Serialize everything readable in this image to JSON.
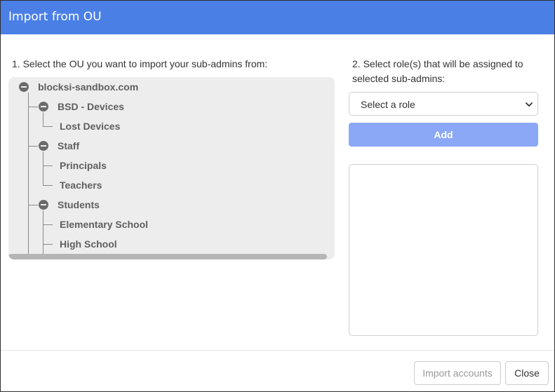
{
  "dialog": {
    "title": "Import from OU"
  },
  "step1": {
    "label": "1. Select the OU you want to import your sub-admins from:"
  },
  "tree": {
    "root": "blocksi-sandbox.com",
    "nodes": [
      {
        "label": "BSD - Devices"
      },
      {
        "label": "Lost Devices"
      },
      {
        "label": "Staff"
      },
      {
        "label": "Principals"
      },
      {
        "label": "Teachers"
      },
      {
        "label": "Students"
      },
      {
        "label": "Elementary School"
      },
      {
        "label": "High School"
      }
    ]
  },
  "step2": {
    "label": "2. Select role(s) that will be assigned to selected sub-admins:"
  },
  "role_select": {
    "selected": "Select a role"
  },
  "add_button": {
    "label": "Add"
  },
  "footer": {
    "import_label": "Import accounts",
    "close_label": "Close"
  },
  "colors": {
    "header": "#4a7fe6",
    "add_button_disabled": "#8aa8f5",
    "tree_background": "#ededed"
  },
  "icons": {
    "collapse": "minus-circle-icon",
    "dropdown": "chevron-down-icon"
  }
}
